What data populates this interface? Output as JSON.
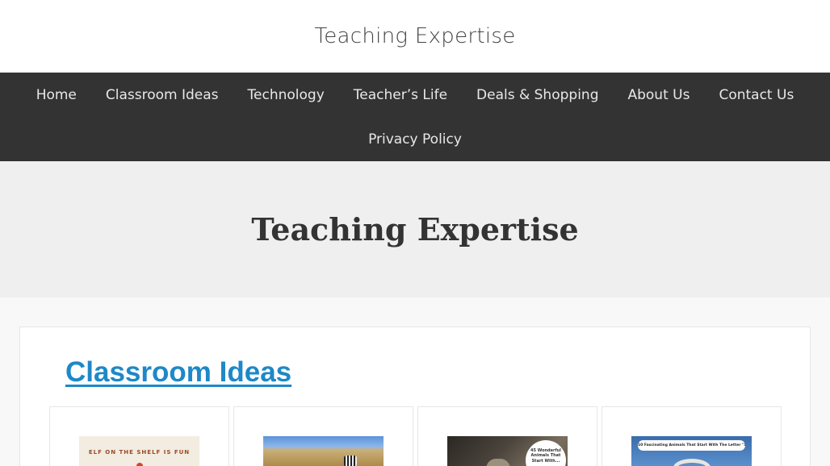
{
  "site": {
    "title": "Teaching Expertise"
  },
  "nav": {
    "row1": [
      "Home",
      "Classroom Ideas",
      "Technology",
      "Teacher’s Life",
      "Deals & Shopping",
      "About Us",
      "Contact Us"
    ],
    "row2": [
      "Privacy Policy"
    ]
  },
  "hero": {
    "title": "Teaching Expertise"
  },
  "section": {
    "title": "Classroom Ideas"
  },
  "posts": [
    {
      "thumb_caption": "ELF ON THE SHELF IS FUN"
    },
    {
      "thumb_caption": ""
    },
    {
      "thumb_caption": "45 Wonderful Animals That Start With..."
    },
    {
      "thumb_caption": "10 Fascinating Animals That Start With The Letter \"X\""
    }
  ],
  "colors": {
    "nav_bg": "#333333",
    "hero_bg": "#efefef",
    "link": "#1e88c8"
  }
}
